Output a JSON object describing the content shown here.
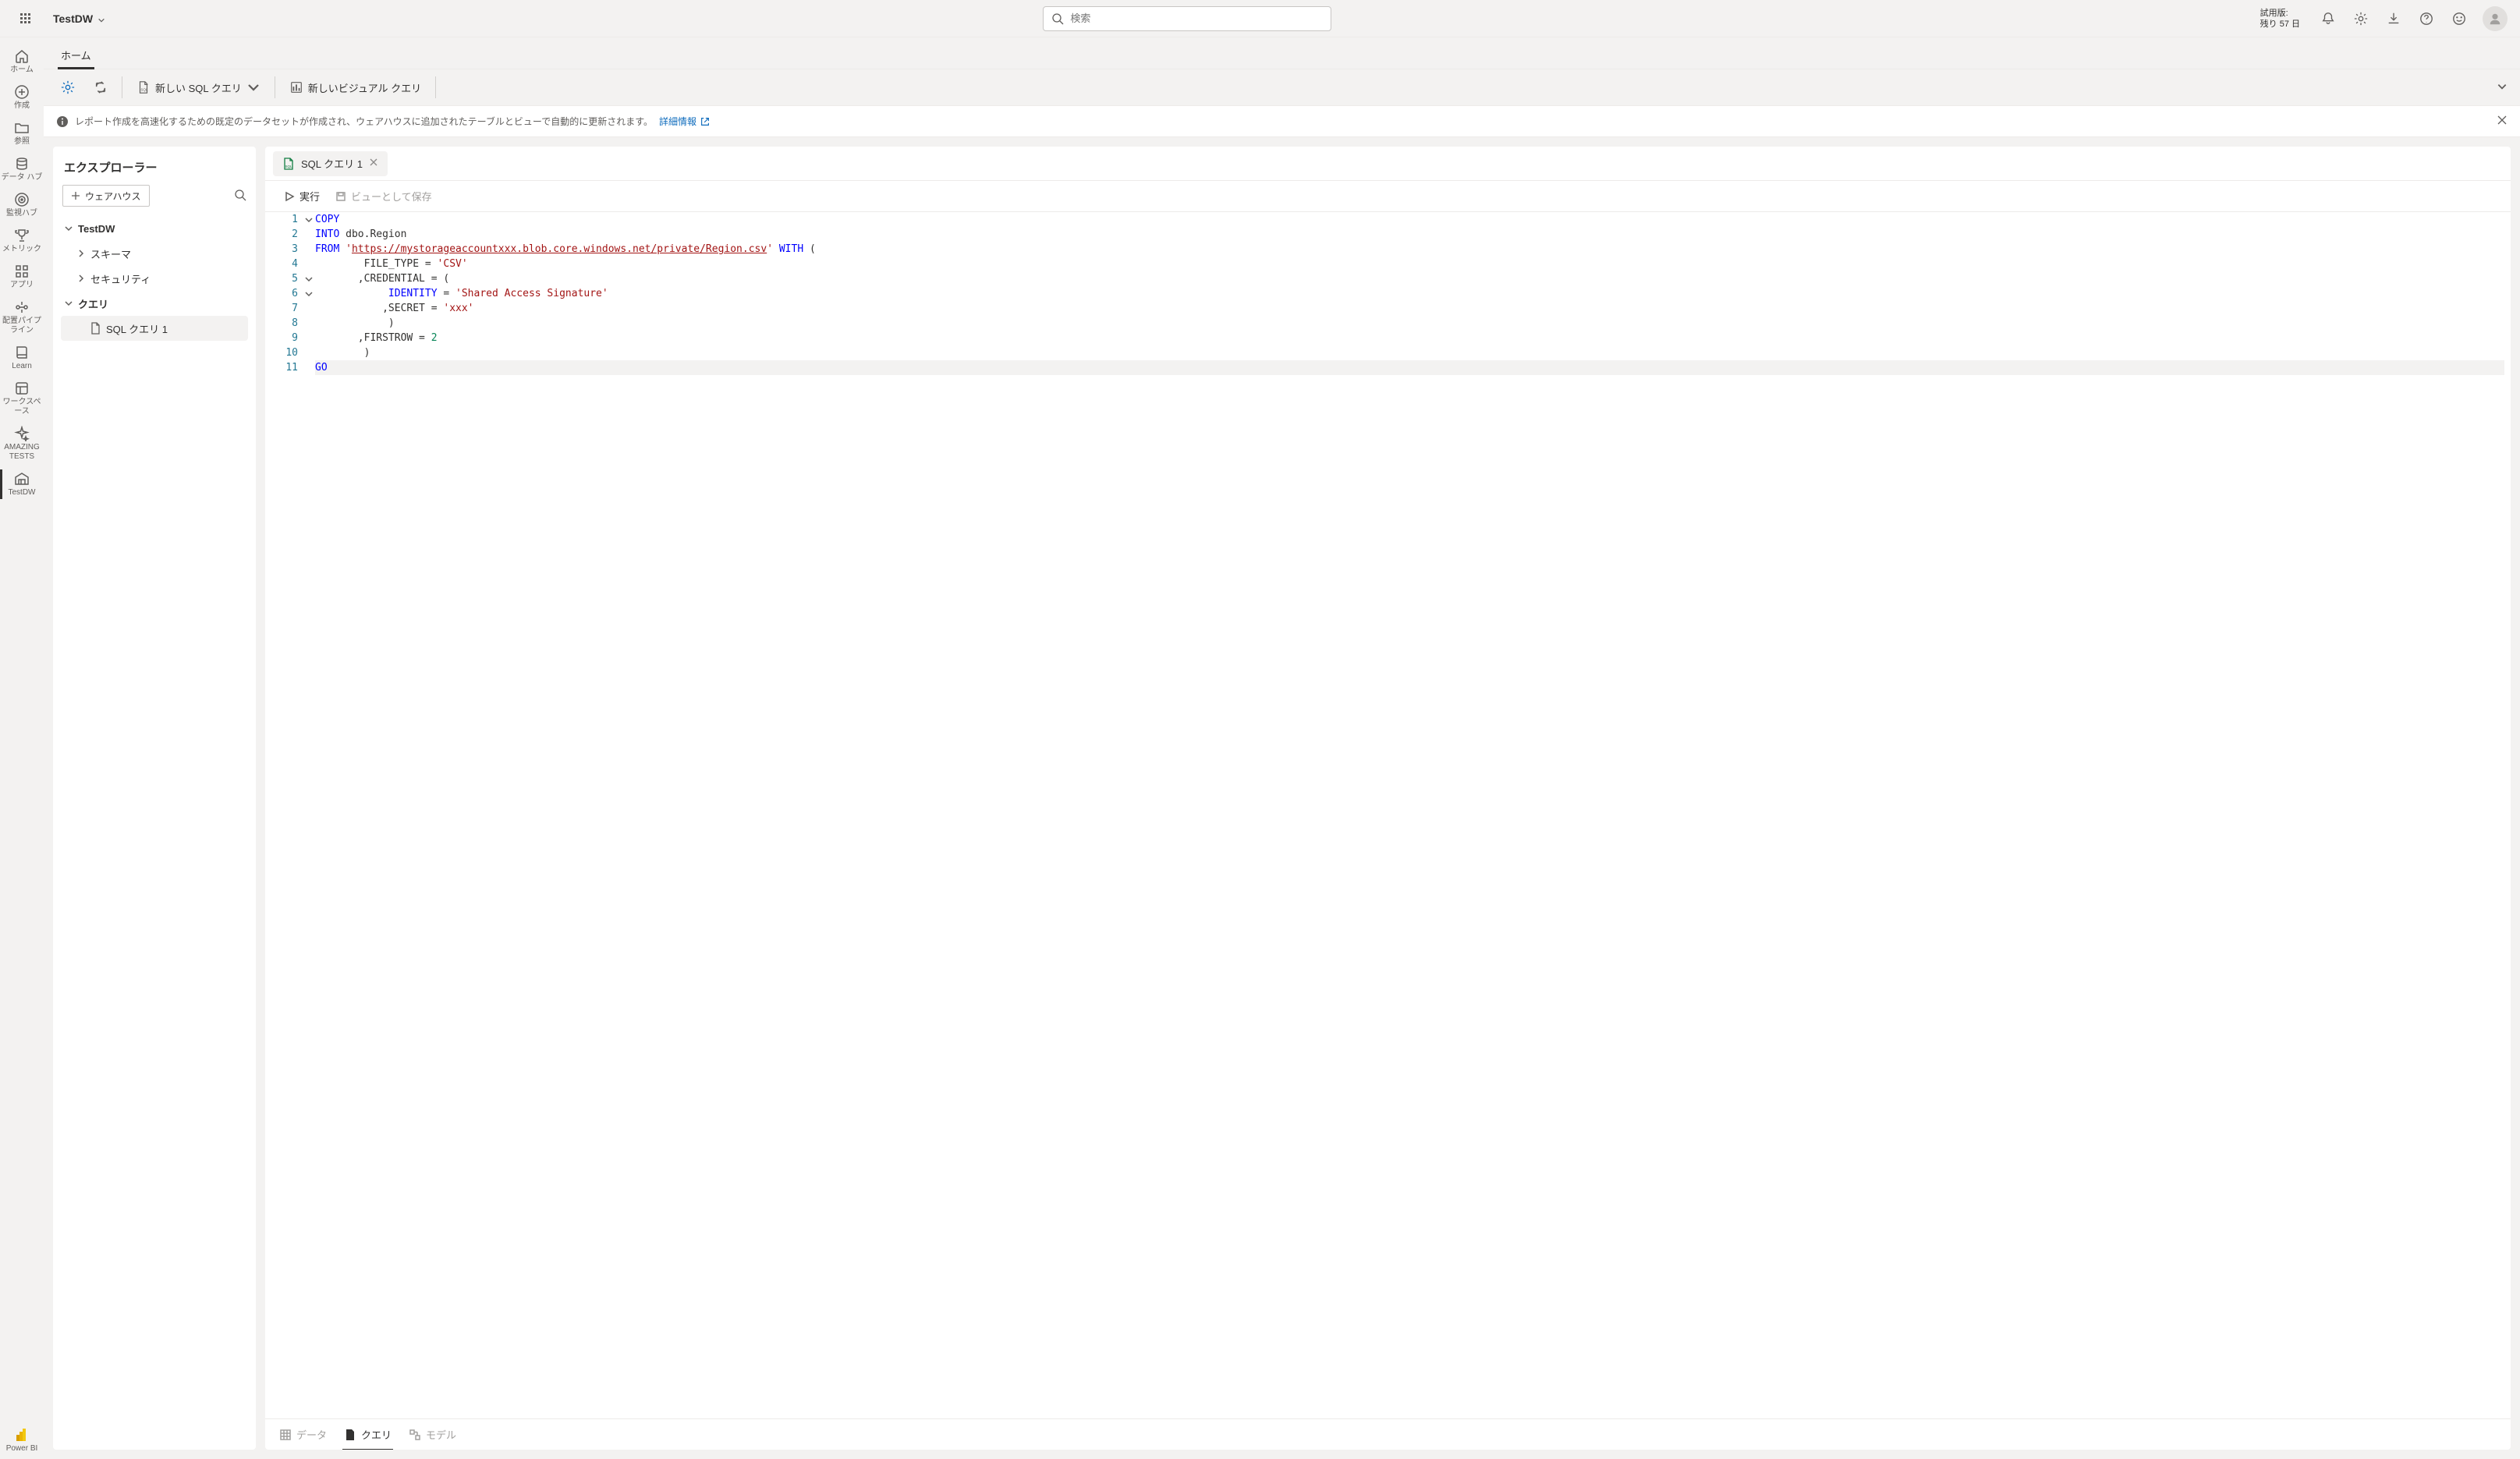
{
  "header": {
    "breadcrumb_title": "TestDW",
    "search_placeholder": "検索",
    "trial_line1": "試用版:",
    "trial_line2": "残り 57 日"
  },
  "left_rail": {
    "items": [
      {
        "label": "ホーム",
        "icon": "home"
      },
      {
        "label": "作成",
        "icon": "plus-circle"
      },
      {
        "label": "参照",
        "icon": "folder"
      },
      {
        "label": "データ ハブ",
        "icon": "stack"
      },
      {
        "label": "監視ハブ",
        "icon": "radar"
      },
      {
        "label": "メトリック",
        "icon": "trophy"
      },
      {
        "label": "アプリ",
        "icon": "apps"
      },
      {
        "label": "配置パイプライン",
        "icon": "pipeline"
      },
      {
        "label": "Learn",
        "icon": "book"
      },
      {
        "label": "ワークスペース",
        "icon": "workspace"
      },
      {
        "label": "AMAZING TESTS",
        "icon": "sparkle"
      },
      {
        "label": "TestDW",
        "icon": "warehouse",
        "active": true
      }
    ],
    "footer_label": "Power BI"
  },
  "tabs": {
    "home": "ホーム"
  },
  "toolbar": {
    "new_sql_query": "新しい SQL クエリ",
    "new_visual_query": "新しいビジュアル クエリ"
  },
  "banner": {
    "text": "レポート作成を高速化するための既定のデータセットが作成され、ウェアハウスに追加されたテーブルとビューで自動的に更新されます。",
    "link": "詳細情報"
  },
  "explorer": {
    "title": "エクスプローラー",
    "warehouse_btn": "ウェアハウス",
    "tree": {
      "root": "TestDW",
      "schema": "スキーマ",
      "security": "セキュリティ",
      "queries": "クエリ",
      "query1": "SQL クエリ 1"
    }
  },
  "editor": {
    "tab_label": "SQL クエリ 1",
    "run": "実行",
    "save_as_view": "ビューとして保存",
    "code": {
      "l1": {
        "kw": "COPY"
      },
      "l2": {
        "kw": "INTO",
        "rest": " dbo.Region"
      },
      "l3": {
        "kw": "FROM",
        "q1": "'",
        "url": "https://mystorageaccountxxx.blob.core.windows.net/private/Region.csv",
        "q2": "'",
        "with": "WITH",
        "paren": " ("
      },
      "l4": {
        "pre": "        FILE_TYPE = ",
        "str": "'CSV'"
      },
      "l5": {
        "pre": "       ,CREDENTIAL = ("
      },
      "l6": {
        "pre": "            ",
        "id": "IDENTITY",
        "mid": " = ",
        "str": "'Shared Access Signature'"
      },
      "l7": {
        "pre": "           ,SECRET = ",
        "str": "'xxx'"
      },
      "l8": {
        "pre": "            )"
      },
      "l9": {
        "pre": "       ,FIRSTROW = ",
        "num": "2"
      },
      "l10": {
        "pre": "        )"
      },
      "l11": {
        "kw": "GO"
      }
    }
  },
  "bottom_tabs": {
    "data": "データ",
    "query": "クエリ",
    "model": "モデル"
  }
}
